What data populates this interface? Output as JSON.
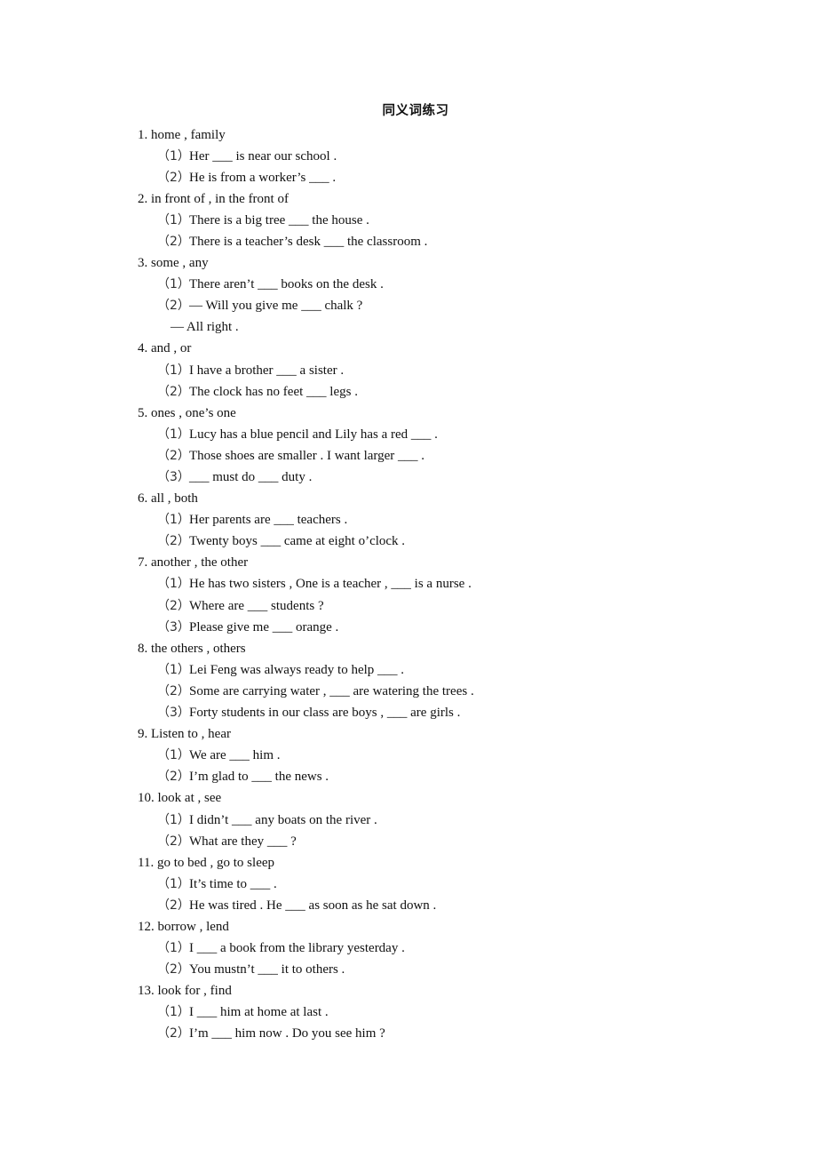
{
  "document": {
    "title": "同义词练习",
    "sections": [
      {
        "heading": "1. home , family",
        "items": [
          {
            "num": "（1）",
            "text": "Her ___ is near our school ."
          },
          {
            "num": "（2）",
            "text": "He is from a worker’s ___ ."
          }
        ]
      },
      {
        "heading": "2. in front of , in the front of",
        "items": [
          {
            "num": "（1）",
            "text": "There is a big tree ___ the house ."
          },
          {
            "num": "（2）",
            "text": "There is a teacher’s desk ___ the classroom ."
          }
        ]
      },
      {
        "heading": "3. some , any",
        "items": [
          {
            "num": "（1）",
            "text": "There aren’t ___ books on the desk ."
          },
          {
            "num": "（2）",
            "text": "— Will you give me ___ chalk ?",
            "continuation": "— All right ."
          }
        ]
      },
      {
        "heading": "4. and , or",
        "items": [
          {
            "num": "（1）",
            "text": "I have a brother ___ a sister ."
          },
          {
            "num": "（2）",
            "text": "The clock has no feet ___ legs ."
          }
        ]
      },
      {
        "heading": "5. ones , one’s one",
        "items": [
          {
            "num": "（1）",
            "text": "Lucy has a blue pencil and Lily has a red ___ ."
          },
          {
            "num": "（2）",
            "text": "Those shoes are smaller . I want larger ___ ."
          },
          {
            "num": "（3）",
            "text": "___ must do ___ duty ."
          }
        ]
      },
      {
        "heading": "6. all , both",
        "items": [
          {
            "num": "（1）",
            "text": "Her parents are ___ teachers ."
          },
          {
            "num": "（2）",
            "text": "Twenty boys ___ came at eight o’clock ."
          }
        ]
      },
      {
        "heading": "7. another , the other",
        "items": [
          {
            "num": "（1）",
            "text": "He has two sisters , One is a teacher , ___ is a nurse ."
          },
          {
            "num": "（2）",
            "text": "Where are ___ students ?"
          },
          {
            "num": "（3）",
            "text": "Please give me ___ orange ."
          }
        ]
      },
      {
        "heading": "8. the others , others",
        "items": [
          {
            "num": "（1）",
            "text": "Lei Feng was always ready to help ___ ."
          },
          {
            "num": "（2）",
            "text": "Some are carrying water , ___ are watering the trees ."
          },
          {
            "num": "（3）",
            "text": "Forty students in our class are boys , ___ are girls ."
          }
        ]
      },
      {
        "heading": "9. Listen to , hear",
        "items": [
          {
            "num": "（1）",
            "text": "We are ___ him ."
          },
          {
            "num": "（2）",
            "text": "I’m glad to ___ the news ."
          }
        ]
      },
      {
        "heading": "10. look at , see",
        "items": [
          {
            "num": "（1）",
            "text": "I didn’t ___ any boats on the river ."
          },
          {
            "num": "（2）",
            "text": "What are they ___ ?"
          }
        ]
      },
      {
        "heading": "11. go to bed , go to sleep",
        "items": [
          {
            "num": "（1）",
            "text": "It’s time to ___ ."
          },
          {
            "num": "（2）",
            "text": "He was tired . He ___ as soon as he sat down ."
          }
        ]
      },
      {
        "heading": "12. borrow , lend",
        "items": [
          {
            "num": "（1）",
            "text": "I ___ a book from the library yesterday ."
          },
          {
            "num": "（2）",
            "text": "You mustn’t ___ it to others ."
          }
        ]
      },
      {
        "heading": "13. look for , find",
        "items": [
          {
            "num": "（1）",
            "text": "I ___ him at home at last ."
          },
          {
            "num": "（2）",
            "text": "I’m ___ him now . Do you see him ?"
          }
        ]
      }
    ]
  }
}
